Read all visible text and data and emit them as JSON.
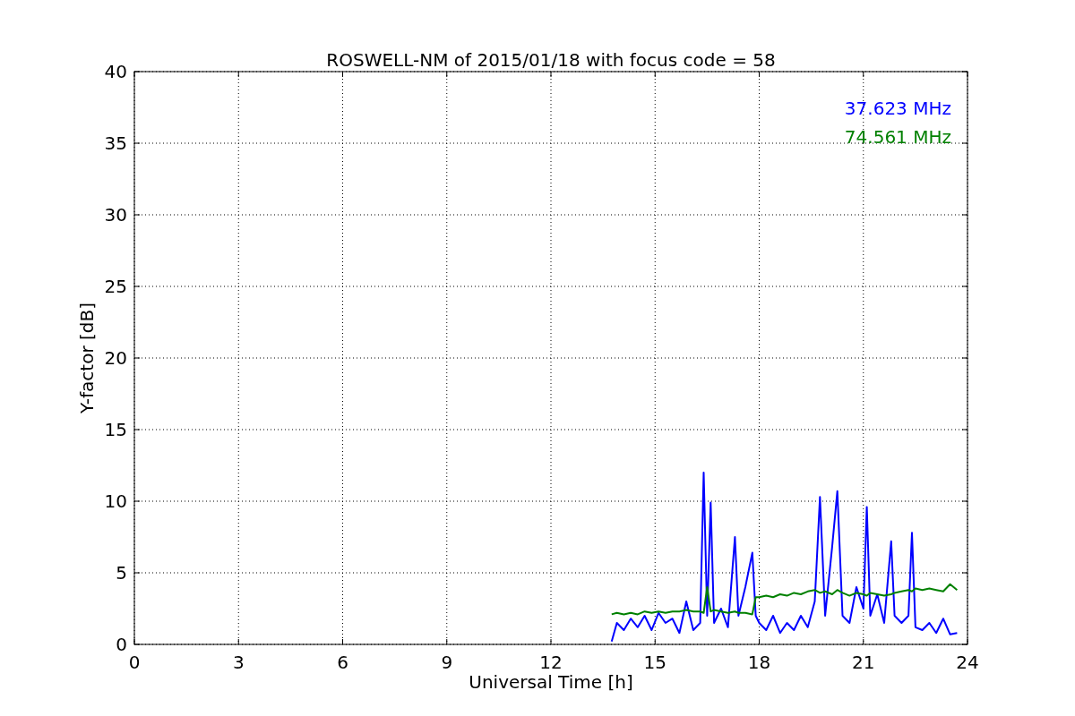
{
  "chart_data": {
    "type": "line",
    "title": "ROSWELL-NM of 2015/01/18 with focus code = 58",
    "xlabel": "Universal Time [h]",
    "ylabel": "Y-factor [dB]",
    "x": [
      13.75,
      13.9,
      14.1,
      14.3,
      14.5,
      14.7,
      14.9,
      15.1,
      15.3,
      15.5,
      15.7,
      15.9,
      16.1,
      16.3,
      16.4,
      16.5,
      16.6,
      16.7,
      16.9,
      17.1,
      17.3,
      17.4,
      17.6,
      17.8,
      17.9,
      18.0,
      18.2,
      18.4,
      18.6,
      18.8,
      19.0,
      19.2,
      19.4,
      19.6,
      19.75,
      19.9,
      20.1,
      20.25,
      20.4,
      20.6,
      20.8,
      21.0,
      21.1,
      21.2,
      21.4,
      21.6,
      21.8,
      21.9,
      22.1,
      22.3,
      22.4,
      22.5,
      22.7,
      22.9,
      23.1,
      23.3,
      23.5,
      23.7
    ],
    "series": [
      {
        "name": "37.623 MHz",
        "color": "#0000ff",
        "values": [
          0.2,
          1.5,
          1.0,
          1.8,
          1.2,
          2.0,
          1.0,
          2.2,
          1.5,
          1.8,
          0.8,
          3.0,
          1.0,
          1.5,
          12.0,
          2.0,
          9.9,
          1.5,
          2.5,
          1.2,
          7.5,
          2.0,
          4.0,
          6.4,
          2.0,
          1.5,
          1.0,
          2.0,
          0.8,
          1.5,
          1.0,
          2.0,
          1.2,
          3.0,
          10.3,
          2.0,
          6.8,
          10.7,
          2.0,
          1.5,
          4.0,
          2.5,
          9.6,
          2.0,
          3.5,
          1.5,
          7.2,
          2.0,
          1.5,
          2.0,
          7.8,
          1.2,
          1.0,
          1.5,
          0.8,
          1.8,
          0.7,
          0.8
        ]
      },
      {
        "name": "74.561 MHz",
        "color": "#008000",
        "values": [
          2.1,
          2.2,
          2.1,
          2.2,
          2.1,
          2.3,
          2.2,
          2.3,
          2.2,
          2.3,
          2.3,
          2.4,
          2.3,
          2.3,
          2.2,
          4.0,
          2.3,
          2.4,
          2.3,
          2.2,
          2.3,
          2.2,
          2.2,
          2.1,
          3.3,
          3.3,
          3.4,
          3.3,
          3.5,
          3.4,
          3.6,
          3.5,
          3.7,
          3.8,
          3.6,
          3.7,
          3.5,
          3.8,
          3.6,
          3.4,
          3.6,
          3.5,
          3.4,
          3.6,
          3.5,
          3.4,
          3.5,
          3.6,
          3.7,
          3.8,
          3.7,
          3.9,
          3.8,
          3.9,
          3.8,
          3.7,
          4.2,
          3.8
        ]
      }
    ],
    "grid": true,
    "xlim": [
      0,
      24
    ],
    "ylim": [
      0,
      40
    ],
    "xticks": [
      0,
      3,
      6,
      9,
      12,
      15,
      18,
      21,
      24
    ],
    "yticks": [
      0,
      5,
      10,
      15,
      20,
      25,
      30,
      35,
      40
    ]
  }
}
